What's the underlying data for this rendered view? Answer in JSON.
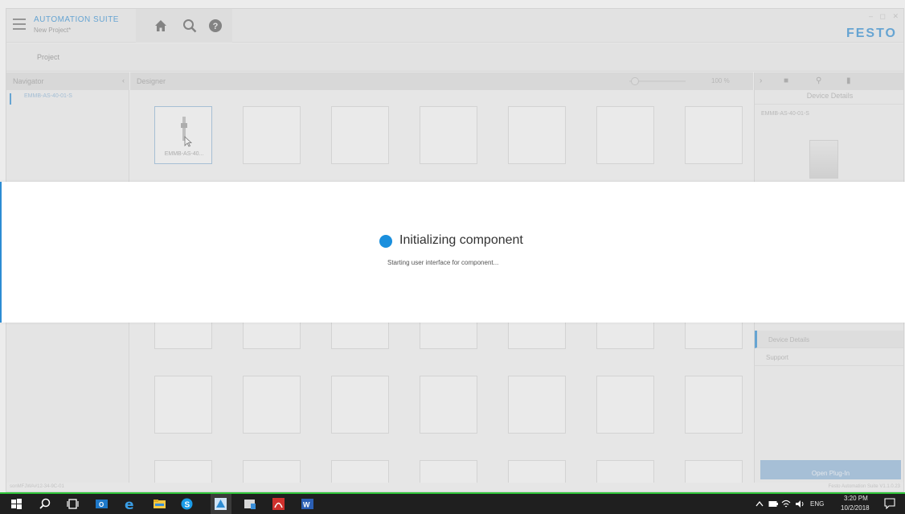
{
  "app": {
    "title": "AUTOMATION SUITE",
    "project_name": "New Project*",
    "brand": "FESTO",
    "window_controls": [
      "–",
      "◻",
      "✕"
    ]
  },
  "toolbar": {
    "icons": [
      "home-icon",
      "search-icon",
      "help-icon"
    ]
  },
  "menu": {
    "project": "Project"
  },
  "navigator": {
    "title": "Navigator",
    "collapse": "‹",
    "item": "EMMB-AS-40-01-S"
  },
  "designer": {
    "title": "Designer",
    "zoom": "100 %",
    "zoom_slider_value": 0.1,
    "selected_tile_label": "EMMB-AS-40..."
  },
  "right_panel": {
    "toolbar_icons": [
      "chevron-right-icon",
      "folder-icon",
      "search-icon",
      "document-icon"
    ],
    "title": "Device Details",
    "device_name": "EMMB-AS-40-01-S",
    "tabs": [
      "Device Details",
      "Support"
    ],
    "open_plugin": "Open Plug-In"
  },
  "status": {
    "left": "sonMFJWA#12-34-9C-01",
    "right": "Festo Automation Suite V1.1.0.23"
  },
  "overlay": {
    "title": "Initializing component",
    "subtitle": "Starting user interface for component..."
  },
  "taskbar": {
    "apps": [
      "windows-icon",
      "search-icon",
      "task-view-icon",
      "outlook-icon",
      "edge-icon",
      "file-explorer-icon",
      "skype-icon",
      "automation-suite-icon",
      "app-icon",
      "acrobat-icon",
      "word-icon"
    ],
    "ime": "ENG",
    "time": "3:20 PM",
    "date": "10/2/2018"
  },
  "colors": {
    "accent": "#2d8cd3",
    "taskbar": "#1f1f1f",
    "progress": "#31c63a"
  }
}
